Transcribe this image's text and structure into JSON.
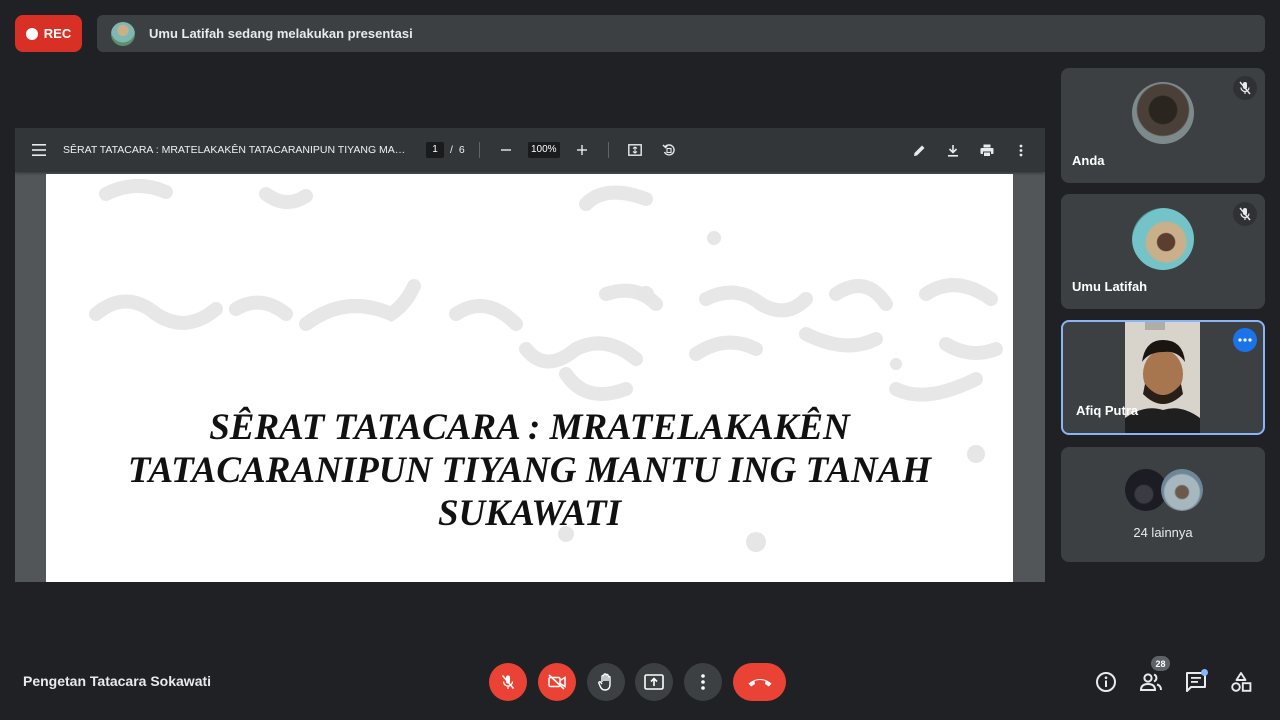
{
  "top_bar": {
    "rec_label": "REC",
    "presenting_text": "Umu Latifah sedang melakukan presentasi"
  },
  "pdf": {
    "title": "SÊRAT TATACARA : MRATELAKAKÊN TATACARANIPUN TIYANG MAN...",
    "current_page": "1",
    "page_separator": "/",
    "total_pages": "6",
    "zoom": "100%",
    "slide_title": [
      "SÊRAT TATACARA : MRATELAKAKÊN",
      "TATACARANIPUN TIYANG MANTU ING TANAH",
      "SUKAWATI"
    ]
  },
  "participants": [
    {
      "name": "Anda",
      "muted": true,
      "icon": "mic-off-icon"
    },
    {
      "name": "Umu Latifah",
      "muted": true,
      "icon": "mic-off-icon"
    },
    {
      "name": "Afiq Putra",
      "active": true,
      "icon": "more-options-icon"
    }
  ],
  "others_label": "24 lainnya",
  "meeting": {
    "name": "Pengetan Tatacara Sokawati"
  },
  "controls": {
    "participant_count": "28"
  },
  "colors": {
    "background": "#202124",
    "tile": "#3c4043",
    "danger": "#ea4335",
    "accent": "#8ab4f8"
  }
}
